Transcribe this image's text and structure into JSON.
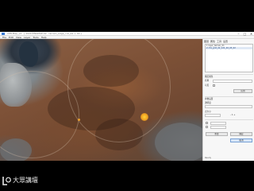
{
  "window": {
    "title": "LEB-Map_v2 · [ 2020-ENGMAP-02 · terrain_edge_cut_ws + 40 ]",
    "minimize": "–",
    "maximize": "□",
    "close": "✕"
  },
  "menu": [
    "File",
    "Edit",
    "View",
    "Layer",
    "Tools",
    "Help"
  ],
  "panel": {
    "tabs": [
      "图层",
      "属性",
      "工具",
      "设置"
    ],
    "list": [
      "1  layer_terrain_01",
      "2  ch1_grid_02_121_02_03_02",
      "",
      "",
      "",
      ""
    ],
    "selected_index": 1,
    "section1_label": "图层属性",
    "field_label_a": "名称",
    "field_label_b": "可见",
    "section2_label": "参数设置",
    "opacity_label": "透明度",
    "size_label": "点大小",
    "size_value": "- 1 +",
    "btn_apply": "应用",
    "btn_reset": "重置",
    "btn_ok": "确定",
    "btn_cancel": "取消",
    "status": "Ready"
  },
  "watermark": {
    "text": "大眾講壇"
  },
  "colors": {
    "accent": "#3a7bd5",
    "marker": "#f0a020"
  },
  "icons": [
    "app-icon",
    "location-marker-icon",
    "logo-mark-icon"
  ]
}
